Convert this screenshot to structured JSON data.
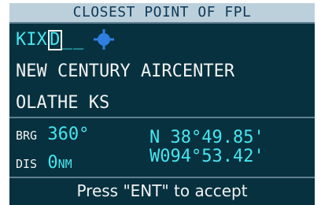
{
  "title": "CLOSEST POINT OF FPL",
  "waypoint": {
    "ident_prefix": "KIX",
    "ident_cursor": "D",
    "ident_blanks": "__",
    "icon": "airport-icon",
    "facility_name": "NEW CENTURY AIRCENTER",
    "city": "OLATHE KS"
  },
  "nav": {
    "brg_label": "BRG",
    "brg_value": "360°",
    "dis_label": "DIS",
    "dis_value": "0",
    "dis_unit": "NM",
    "latitude": "N 38°49.85'",
    "longitude": "W094°53.42'"
  },
  "prompt": "Press \"ENT\" to accept",
  "colors": {
    "background": "#07313f",
    "title_bg": "#bcd0dc",
    "title_text": "#0e3a58",
    "cyan": "#46e6f0",
    "white": "#f2f2f2"
  }
}
